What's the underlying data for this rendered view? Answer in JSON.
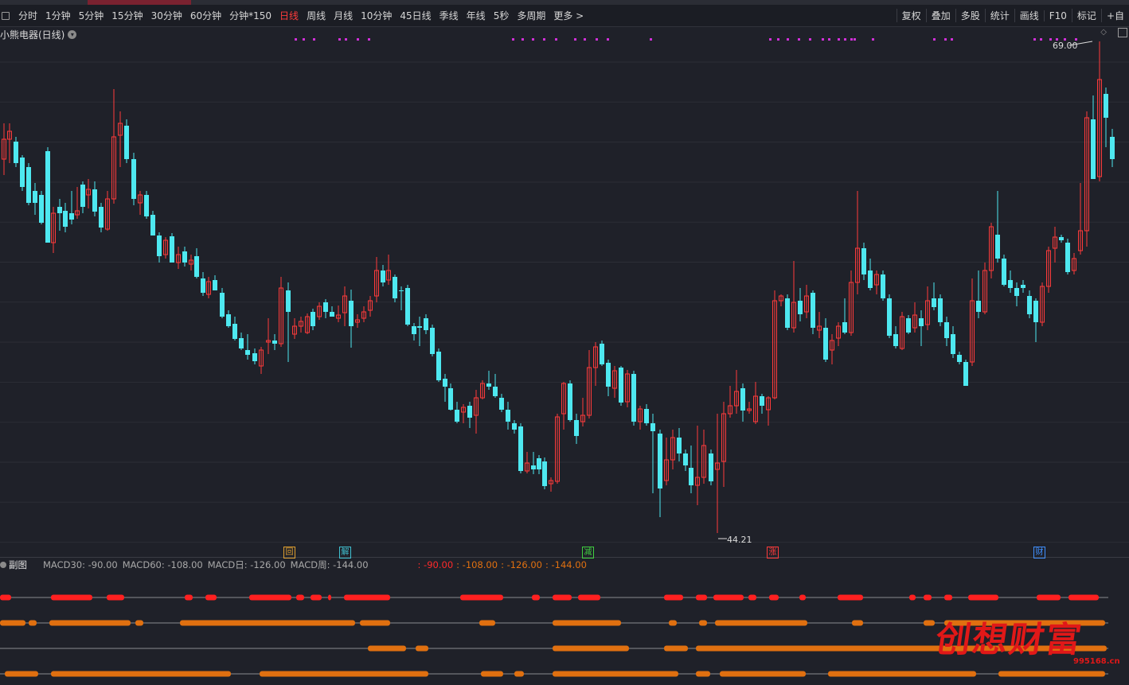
{
  "toolbar": {
    "periods": [
      "分时",
      "1分钟",
      "5分钟",
      "15分钟",
      "30分钟",
      "60分钟",
      "分钟*150",
      "日线",
      "周线",
      "月线",
      "10分钟",
      "45日线",
      "季线",
      "年线",
      "5秒",
      "多周期",
      "更多 >"
    ],
    "active_period": "日线",
    "right_items": [
      "复权",
      "叠加",
      "多股",
      "统计",
      "画线",
      "F10",
      "标记",
      "+自"
    ]
  },
  "chart": {
    "title": "小熊电器(日线)",
    "high_label": "69.00",
    "low_label": "44.21",
    "colors": {
      "up": "#ff3b3b",
      "down": "#4ee8f0",
      "magenta": "#d030d8",
      "bg": "#1f2129"
    }
  },
  "signals": [
    {
      "text": "回",
      "color": "#e0a030",
      "border": "#e0a030"
    },
    {
      "text": "解",
      "color": "#40c0d0",
      "border": "#40c0d0"
    },
    {
      "text": "减",
      "color": "#40d040",
      "border": "#40d040"
    },
    {
      "text": "涨",
      "color": "#ff3b3b",
      "border": "#ff3b3b"
    },
    {
      "text": "财",
      "color": "#4090ff",
      "border": "#4090ff"
    }
  ],
  "sub": {
    "label": "副图",
    "items": [
      "MACD30: -90.00",
      "MACD60: -108.00",
      "MACD日: -126.00",
      "MACD周: -144.00"
    ],
    "values": [
      ": -90.00",
      ": -108.00",
      ": -126.00",
      ": -144.00"
    ]
  },
  "watermark": {
    "text": "创想财富",
    "url": "995168.cn"
  }
}
